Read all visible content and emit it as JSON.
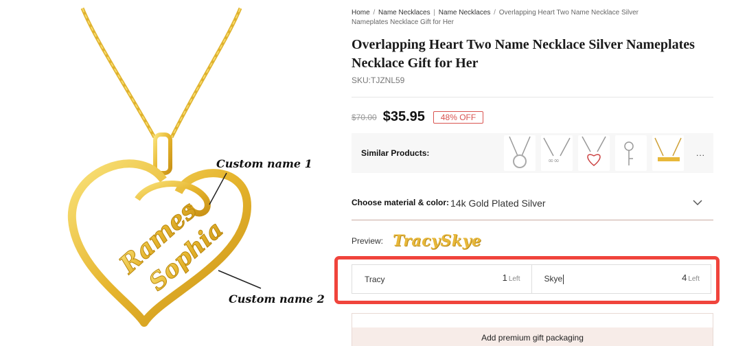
{
  "breadcrumb": {
    "items": [
      "Home",
      "Name Necklaces",
      "Name Necklaces"
    ],
    "separator": "/",
    "current": "Overlapping Heart Two Name Necklace Silver Nameplates Necklace Gift for Her"
  },
  "product": {
    "title": "Overlapping Heart Two Name Necklace Silver Nameplates Necklace Gift for Her",
    "sku": "SKU:TJZNL59",
    "old_price": "$70.00",
    "price": "$35.95",
    "discount": "48% OFF",
    "image": {
      "annotation_1": "Custom name 1",
      "annotation_2": "Custom name 2",
      "engraved_name_1": "Rames",
      "engraved_name_2": "Sophia"
    }
  },
  "similar": {
    "label": "Similar Products:",
    "thumbnails": [
      "necklace-thumb-1",
      "necklace-thumb-2",
      "necklace-thumb-3",
      "necklace-thumb-4",
      "necklace-thumb-5"
    ],
    "more": "..."
  },
  "material": {
    "label": "Choose material & color:",
    "value": "14k Gold Plated Silver"
  },
  "preview": {
    "label": "Preview:",
    "name_1": "Tracy",
    "name_2": "Skye"
  },
  "inputs": [
    {
      "value": "Tracy",
      "count": "1",
      "count_suffix": "Left"
    },
    {
      "value": "Skye",
      "count": "4",
      "count_suffix": "Left"
    }
  ],
  "gift": {
    "label": "Add premium gift packaging"
  },
  "colors": {
    "gold": "#e8b83a",
    "highlight": "#f0443c",
    "discount": "#d9534f"
  }
}
